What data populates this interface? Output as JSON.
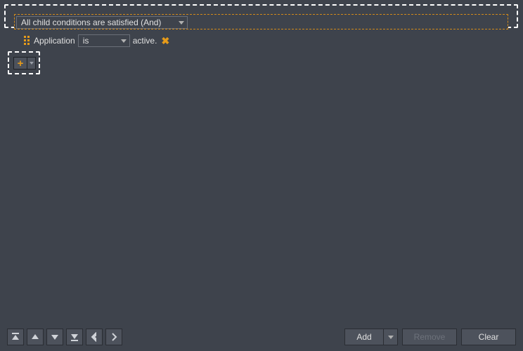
{
  "root_condition": {
    "dropdown_value": "All child conditions are satisfied (And)"
  },
  "rule": {
    "subject": "Application",
    "operator": "is",
    "suffix": "active."
  },
  "footer": {
    "add_label": "Add",
    "remove_label": "Remove",
    "clear_label": "Clear"
  }
}
